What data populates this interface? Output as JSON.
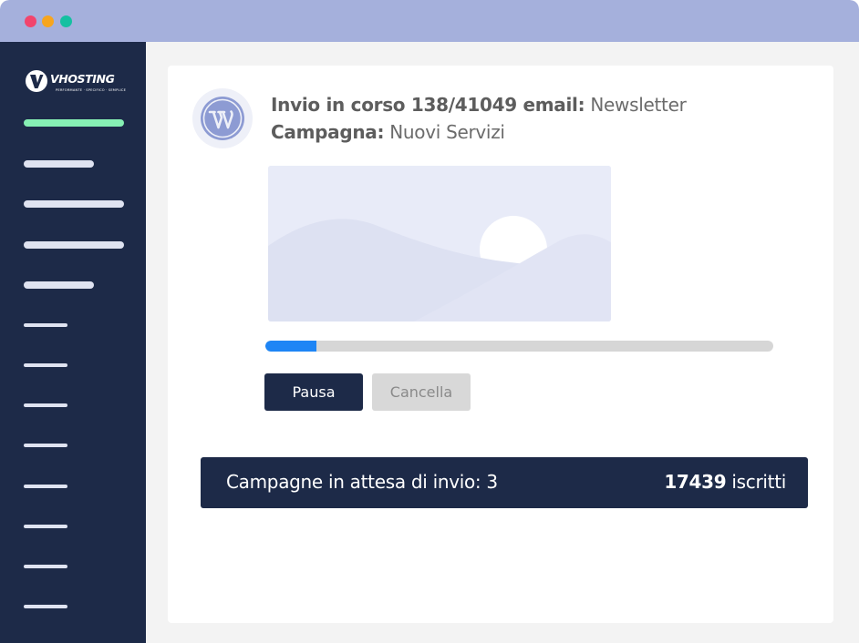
{
  "window": {
    "controls": [
      "close",
      "minimize",
      "maximize"
    ]
  },
  "sidebar": {
    "logo": {
      "brand": "VHOSTING",
      "tagline": "PERFORMANTE · SPECIFICO · SEMPLICE"
    },
    "nav_items": [
      {
        "state": "active"
      },
      {
        "state": "inactive"
      },
      {
        "state": "inactive"
      },
      {
        "state": "inactive"
      },
      {
        "state": "inactive"
      },
      {
        "state": "inactive"
      },
      {
        "state": "inactive"
      },
      {
        "state": "inactive"
      },
      {
        "state": "inactive"
      },
      {
        "state": "inactive"
      },
      {
        "state": "inactive"
      },
      {
        "state": "inactive"
      },
      {
        "state": "inactive"
      }
    ]
  },
  "campaign": {
    "sending_prefix": "Invio in corso 138/41049 email:",
    "newsletter_name": "Newsletter",
    "campaign_label": "Campagna:",
    "campaign_name": "Nuovi Servizi",
    "progress_sent": 138,
    "progress_total": 41049,
    "progress_fraction": 0.1
  },
  "actions": {
    "pause_label": "Pausa",
    "cancel_label": "Cancella"
  },
  "queue": {
    "waiting_text": "Campagne in attesa di invio: 3",
    "subscribers_count": "17439",
    "subscribers_label": "iscritti"
  },
  "colors": {
    "sidebar": "#1d2a48",
    "titlebar": "#a5b0dc",
    "active_nav": "#86f0b4",
    "progress": "#1e85f5",
    "primary_button": "#1d2a48"
  }
}
